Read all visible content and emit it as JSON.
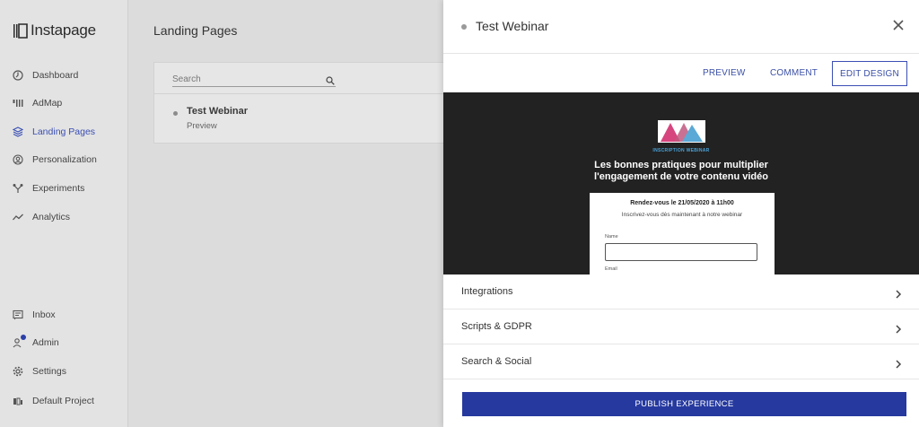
{
  "app": {
    "name": "Instapage"
  },
  "sidebar": {
    "items": [
      {
        "label": "Dashboard",
        "icon": "dashboard-icon"
      },
      {
        "label": "AdMap",
        "icon": "admap-icon"
      },
      {
        "label": "Landing Pages",
        "icon": "layers-icon",
        "active": true
      },
      {
        "label": "Personalization",
        "icon": "personalization-icon"
      },
      {
        "label": "Experiments",
        "icon": "experiments-icon"
      },
      {
        "label": "Analytics",
        "icon": "analytics-icon"
      }
    ],
    "bottom_items": [
      {
        "label": "Inbox",
        "icon": "inbox-icon"
      },
      {
        "label": "Admin",
        "icon": "admin-icon"
      },
      {
        "label": "Settings",
        "icon": "gear-icon"
      },
      {
        "label": "Default Project",
        "icon": "project-icon"
      }
    ]
  },
  "main": {
    "title": "Landing Pages",
    "search": {
      "placeholder": "Search",
      "value": ""
    },
    "pages": [
      {
        "title": "Test Webinar",
        "subtitle": "Preview"
      }
    ]
  },
  "drawer": {
    "title": "Test Webinar",
    "actions": {
      "preview": "PREVIEW",
      "comment": "COMMENT",
      "edit_design": "EDIT DESIGN"
    },
    "preview": {
      "tag": "INSCRIPTION WEBINAR",
      "headline_line1": "Les bonnes pratiques pour multiplier",
      "headline_line2": "l'engagement de votre contenu vidéo",
      "date": "Rendez-vous le 21/05/2020 à 11h00",
      "subtext": "Inscrivez-vous dès maintenant à notre webinar",
      "name_label": "Name",
      "email_label": "Email"
    },
    "sections": [
      {
        "label": "Integrations"
      },
      {
        "label": "Scripts & GDPR"
      },
      {
        "label": "Search & Social"
      }
    ],
    "publish_label": "PUBLISH EXPERIENCE"
  },
  "colors": {
    "accent": "#3b4fb3",
    "publish_button": "#26399f",
    "preview_bg": "#222222",
    "logo_pink": "#d6457e",
    "logo_blue": "#5aa9d6"
  }
}
